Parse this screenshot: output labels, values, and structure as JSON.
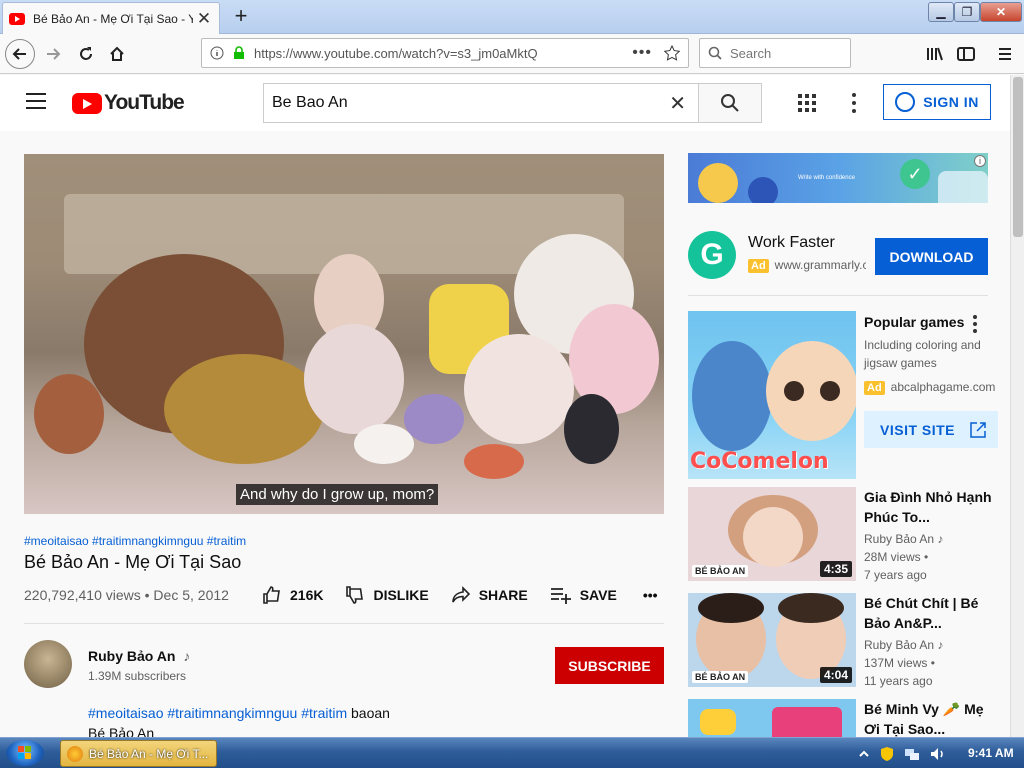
{
  "browser": {
    "tab_title": "Bé Bảo An - Mẹ Ơi Tại Sao - YouTube",
    "tab_close": "✕",
    "new_tab": "+",
    "url": "https://www.youtube.com/watch?v=s3_jm0aMktQ",
    "url_menu": "•••",
    "search_placeholder": "Search",
    "window_controls": {
      "min": "▁",
      "max": "❐",
      "close": "✕"
    }
  },
  "youtube": {
    "logo_text": "YouTube",
    "search_query": "Be Bao An",
    "clear_icon": "✕",
    "signin_label": "SIGN IN"
  },
  "video": {
    "caption": "And why do I grow up, mom?",
    "hashtags": "#meoitaisao #traitimnangkimnguu #traitim",
    "title": "Bé Bảo An - Mẹ Ơi Tại Sao",
    "views_date": "220,792,410 views • Dec 5, 2012",
    "actions": {
      "like_count": "216K",
      "dislike": "DISLIKE",
      "share": "SHARE",
      "save": "SAVE",
      "more": "•••"
    }
  },
  "channel": {
    "name": "Ruby Bảo An",
    "music_note": "♪",
    "subscribers": "1.39M subscribers",
    "subscribe_label": "SUBSCRIBE",
    "desc_tags": "#meoitaisao #traitimnangkimnguu #traitim",
    "desc_word": "baoan",
    "desc_line2": "Bé Bảo An"
  },
  "sidebar": {
    "banner_small_text": "Write with confidence",
    "banner_info": "i",
    "banner_check": "✓",
    "ad1": {
      "logo_letter": "G",
      "title": "Work Faster",
      "ad_label": "Ad",
      "url": "www.grammarly.com",
      "cta": "DOWNLOAD"
    },
    "ad2": {
      "thumb_text": "CoComelon",
      "title": "Popular games",
      "description": "Including coloring and jigsaw games",
      "ad_label": "Ad",
      "url": "abcalphagame.com",
      "cta": "VISIT SITE"
    },
    "recommendations": [
      {
        "title": "Gia Đình Nhỏ Hạnh Phúc To...",
        "channel": "Ruby Bảo An ♪",
        "views": "28M views •",
        "age": "7 years ago",
        "duration": "4:35",
        "brand": "BÉ BẢO AN",
        "thumb_color": "#e9d6d9"
      },
      {
        "title": "Bé Chút Chít | Bé Bảo An&P...",
        "channel": "Ruby Bảo An ♪",
        "views": "137M views •",
        "age": "11 years ago",
        "duration": "4:04",
        "brand": "BÉ BẢO AN",
        "thumb_color": "#bcd6ec"
      },
      {
        "title": "Bé Minh Vy 🥕 Mẹ Ơi Tại Sao...",
        "channel": "",
        "views": "",
        "age": "",
        "duration": "",
        "brand": "",
        "thumb_color": "#7ec8f0"
      }
    ]
  },
  "taskbar": {
    "task_label": "Bé Bảo An - Mẹ Ơi T...",
    "clock": "9:41 AM"
  }
}
